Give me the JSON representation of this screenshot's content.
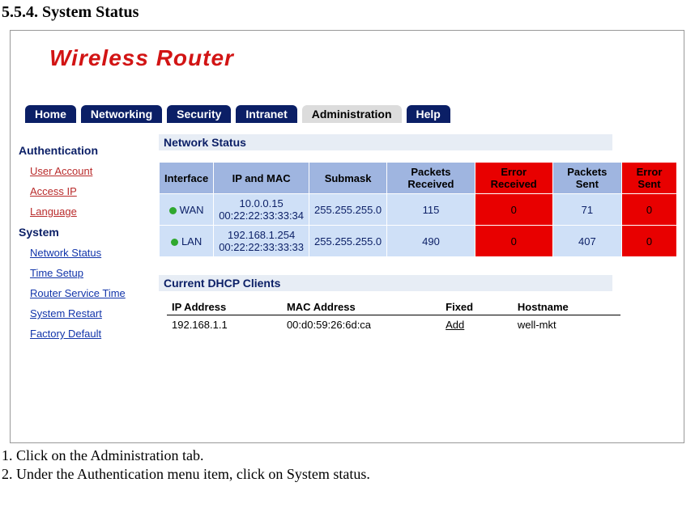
{
  "doc": {
    "heading": "5.5.4. System Status",
    "step1": "1. Click on the Administration tab.",
    "step2": "2. Under the Authentication menu item, click on System status."
  },
  "brand": {
    "title": "Wireless Router"
  },
  "topnav": {
    "home": "Home",
    "networking": "Networking",
    "security": "Security",
    "intranet": "Intranet",
    "administration": "Administration",
    "help": "Help"
  },
  "sidebar": {
    "group_auth": "Authentication",
    "user_account": "User Account",
    "access_ip": "Access IP",
    "language": "Language",
    "group_system": "System",
    "network_status": "Network Status",
    "time_setup": "Time Setup",
    "router_service_time": "Router Service Time",
    "system_restart": "System Restart",
    "factory_default": "Factory Default"
  },
  "network_status": {
    "title": "Network Status",
    "headers": {
      "interface": "Interface",
      "ip_mac": "IP and MAC",
      "submask": "Submask",
      "packets_recv": "Packets Received",
      "error_recv": "Error Received",
      "packets_sent": "Packets Sent",
      "error_sent": "Error Sent"
    },
    "rows": [
      {
        "interface": "WAN",
        "ip": "10.0.0.15",
        "mac": "00:22:22:33:33:34",
        "submask": "255.255.255.0",
        "packets_recv": "115",
        "error_recv": "0",
        "packets_sent": "71",
        "error_sent": "0"
      },
      {
        "interface": "LAN",
        "ip": "192.168.1.254",
        "mac": "00:22:22:33:33:33",
        "submask": "255.255.255.0",
        "packets_recv": "490",
        "error_recv": "0",
        "packets_sent": "407",
        "error_sent": "0"
      }
    ]
  },
  "dhcp": {
    "title": "Current DHCP Clients",
    "headers": {
      "ip": "IP Address",
      "mac": "MAC Address",
      "fixed": "Fixed",
      "hostname": "Hostname"
    },
    "rows": [
      {
        "ip": "192.168.1.1",
        "mac": "00:d0:59:26:6d:ca",
        "fixed": "Add",
        "hostname": "well-mkt"
      }
    ]
  }
}
